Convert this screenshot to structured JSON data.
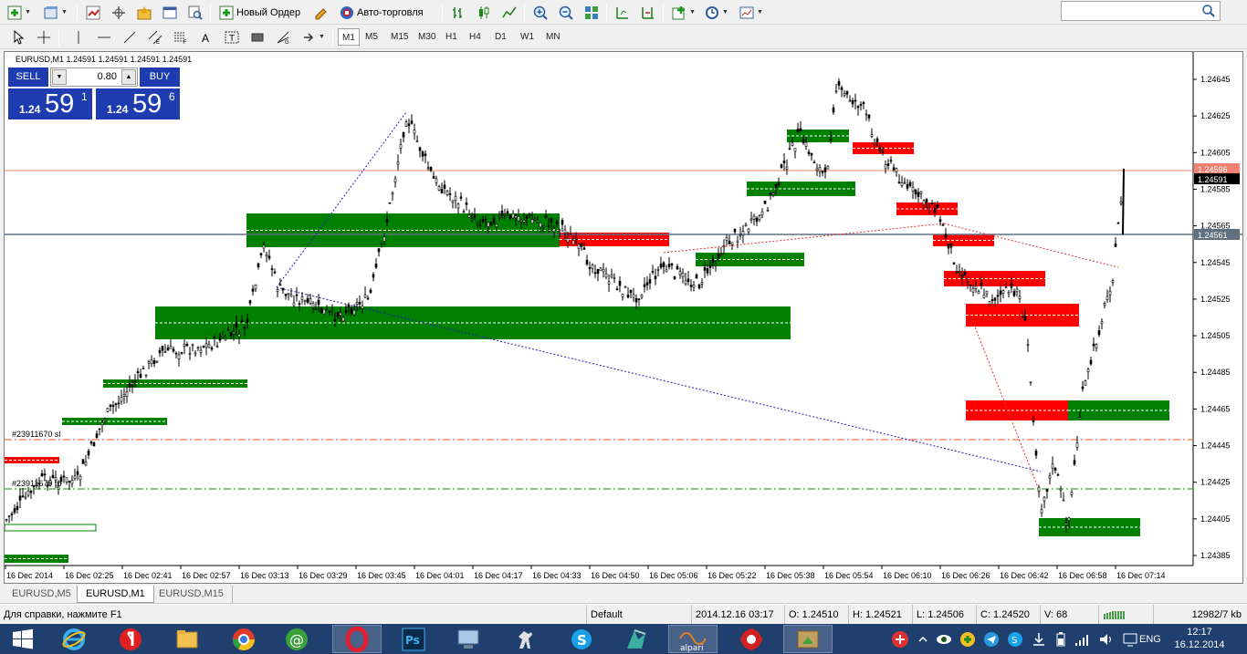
{
  "toolbar": {
    "new_order": "Новый Ордер",
    "auto_trading": "Авто-торговля",
    "timeframes": [
      "M1",
      "M5",
      "M15",
      "M30",
      "H1",
      "H4",
      "D1",
      "W1",
      "MN"
    ],
    "search_placeholder": ""
  },
  "chart": {
    "title": "EURUSD,M1  1.24591 1.24591 1.24591 1.24591",
    "oneclick": {
      "sell": "SELL",
      "buy": "BUY",
      "lot": "0.80",
      "bid_prefix": "1.24",
      "bid_big": "59",
      "bid_sup": "1",
      "ask_prefix": "1.24",
      "ask_big": "59",
      "ask_sup": "6"
    },
    "price_labels": [
      "1.24645",
      "1.24625",
      "1.24605",
      "1.24585",
      "1.24565",
      "1.24545",
      "1.24525",
      "1.24505",
      "1.24485",
      "1.24465",
      "1.24445",
      "1.24425",
      "1.24405",
      "1.24385"
    ],
    "ask_label": "1.24596",
    "bid_label": "1.24591",
    "hline_label": "1.24561",
    "order_label_1": "#23911670 sl",
    "order_label_2": "#23911670 tp",
    "time_labels": [
      "16 Dec 2014",
      "16 Dec 02:25",
      "16 Dec 02:41",
      "16 Dec 02:57",
      "16 Dec 03:13",
      "16 Dec 03:29",
      "16 Dec 03:45",
      "16 Dec 04:01",
      "16 Dec 04:17",
      "16 Dec 04:33",
      "16 Dec 04:50",
      "16 Dec 05:06",
      "16 Dec 05:22",
      "16 Dec 05:38",
      "16 Dec 05:54",
      "16 Dec 06:10",
      "16 Dec 06:26",
      "16 Dec 06:42",
      "16 Dec 06:58",
      "16 Dec 07:14"
    ]
  },
  "tabs": [
    "EURUSD,M5",
    "EURUSD,M1",
    "EURUSD,M15"
  ],
  "status": {
    "help": "Для справки, нажмите F1",
    "profile": "Default",
    "datetime": "2014.12.16 03:17",
    "open": "O: 1.24510",
    "high": "H: 1.24521",
    "low": "L: 1.24506",
    "close": "C: 1.24520",
    "volume": "V: 68",
    "traffic": "12982/7 kb"
  },
  "taskbar": {
    "lang": "ENG",
    "time": "12:17",
    "date": "16.12.2014",
    "alpari_label": "alpari"
  },
  "colors": {
    "bull_zone": "#008000",
    "bear_zone": "#ff0000",
    "accent_blue": "#1e3cb0",
    "taskbar": "#1f3f6e"
  }
}
